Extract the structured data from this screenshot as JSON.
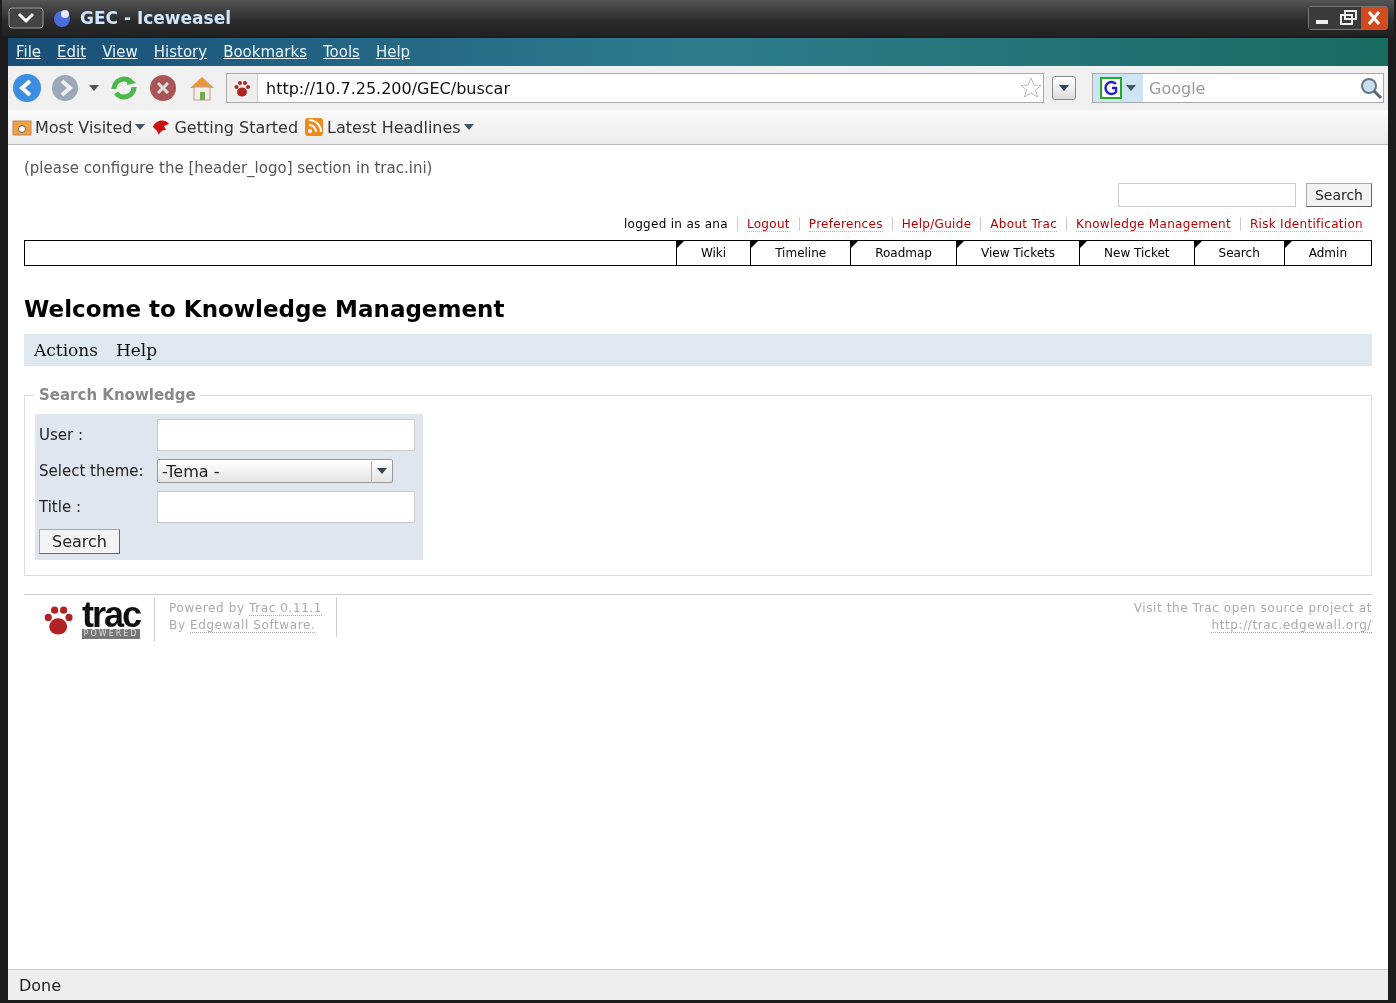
{
  "window": {
    "title": "GEC - Iceweasel"
  },
  "menu": [
    "File",
    "Edit",
    "View",
    "History",
    "Bookmarks",
    "Tools",
    "Help"
  ],
  "address": {
    "url": "http://10.7.25.200/GEC/buscar"
  },
  "web_search": {
    "placeholder": "Google"
  },
  "bookmarks": [
    {
      "label": "Most Visited",
      "kind": "folder",
      "dropdown": true
    },
    {
      "label": "Getting Started",
      "kind": "page",
      "dropdown": false
    },
    {
      "label": "Latest Headlines",
      "kind": "feed",
      "dropdown": true
    }
  ],
  "page": {
    "header_note": "(please configure the [header_logo] section in trac.ini)",
    "search_button": "Search",
    "logged_in": "logged in as ana",
    "meta_links": [
      "Logout",
      "Preferences",
      "Help/Guide",
      "About Trac",
      "Knowledge Management",
      "Risk Identification"
    ],
    "main_nav": [
      {
        "label": "Wiki",
        "selected": false
      },
      {
        "label": "Timeline",
        "selected": false
      },
      {
        "label": "Roadmap",
        "selected": false
      },
      {
        "label": "View Tickets",
        "selected": false
      },
      {
        "label": "New Ticket",
        "selected": false
      },
      {
        "label": "Search",
        "selected": false
      },
      {
        "label": "Admin",
        "selected": false
      }
    ],
    "heading": "Welcome to Knowledge Management",
    "context_menu": [
      "Actions",
      "Help"
    ],
    "form": {
      "legend": "Search Knowledge",
      "fields": [
        {
          "label": "User :",
          "kind": "text"
        },
        {
          "label": "Select theme:",
          "kind": "select",
          "value": "-Tema -"
        },
        {
          "label": "Title :",
          "kind": "text"
        }
      ],
      "submit": "Search"
    },
    "footer": {
      "logo_word": "trac",
      "logo_badge": "POWERED",
      "lines": [
        {
          "text": "Powered by ",
          "link": "Trac 0.11.1"
        },
        {
          "text": "By ",
          "link": "Edgewall Software."
        }
      ],
      "right_text": "Visit the Trac open source project at",
      "right_link": "http://trac.edgewall.org/"
    }
  },
  "status_bar": "Done"
}
